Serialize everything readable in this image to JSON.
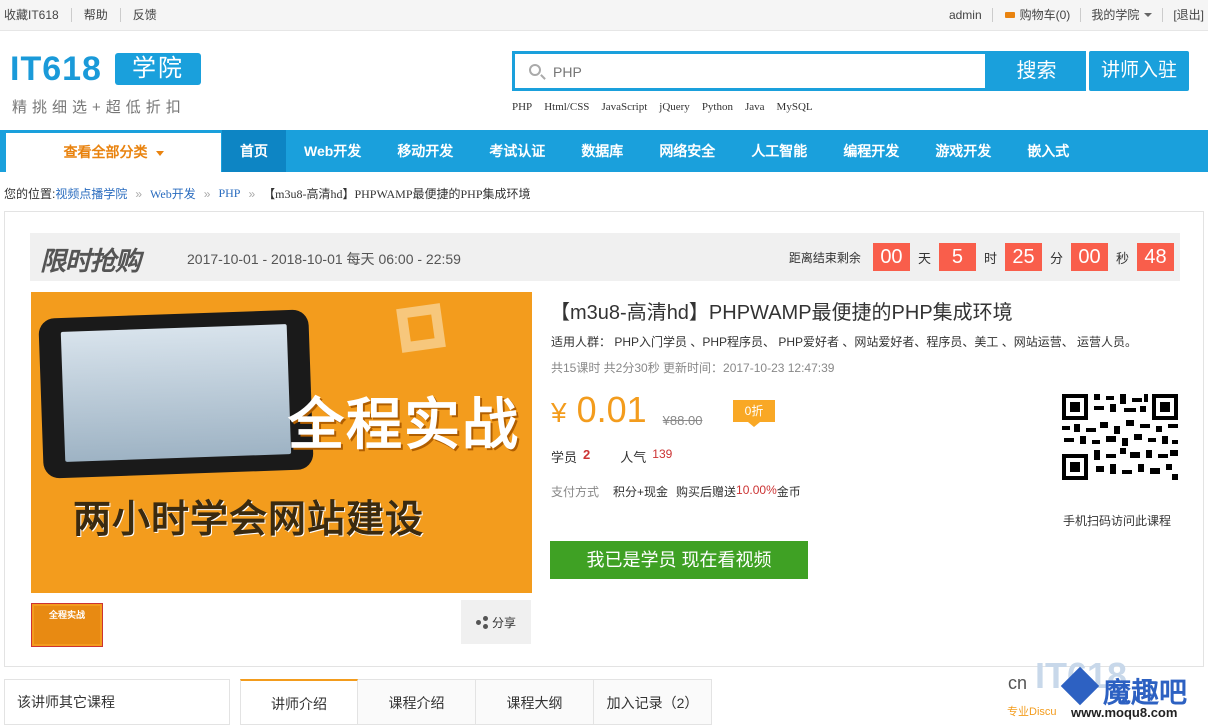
{
  "topbar": {
    "links": [
      "收藏IT618",
      "帮助",
      "反馈"
    ],
    "user": "admin",
    "cart": "购物车(0)",
    "my_school": "我的学院",
    "logout": "[退出]"
  },
  "header": {
    "logo_text": "IT618",
    "logo_badge": "学院",
    "slogan": "精挑细选+超低折扣",
    "search_placeholder": "PHP",
    "search_button": "搜索",
    "teacher_button": "讲师入驻",
    "hotwords": [
      "PHP",
      "Html/CSS",
      "JavaScript",
      "jQuery",
      "Python",
      "Java",
      "MySQL"
    ]
  },
  "nav": {
    "all_categories": "查看全部分类",
    "items": [
      "首页",
      "Web开发",
      "移动开发",
      "考试认证",
      "数据库",
      "网络安全",
      "人工智能",
      "编程开发",
      "游戏开发",
      "嵌入式"
    ]
  },
  "breadcrumb": {
    "label": "您的位置:",
    "items": [
      "视频点播学院",
      "Web开发",
      "PHP"
    ],
    "current": "【m3u8-高清hd】PHPWAMP最便捷的PHP集成环境",
    "separator": "»"
  },
  "flash_sale": {
    "title": "限时抢购",
    "date_range": "2017-10-01 - 2018-10-01 每天 06:00 - 22:59",
    "countdown_label": "距离结束剩余",
    "days": "00",
    "days_unit": "天",
    "hours": "5",
    "hours_unit": "时",
    "minutes": "25",
    "minutes_unit": "分",
    "seconds_a": "00",
    "seconds_unit": "秒",
    "seconds_b": "48"
  },
  "cover": {
    "line1": "全程实战",
    "line2": "两小时学会网站建设",
    "thumb_text": "全程实战"
  },
  "course": {
    "title": "【m3u8-高清hd】PHPWAMP最便捷的PHP集成环境",
    "audience": "适用人群： PHP入门学员 、PHP程序员、 PHP爱好者 、网站爱好者、程序员、美工 、网站运营、 运营人员。",
    "meta": "共15课时 共2分30秒 更新时间：2017-10-23 12:47:39",
    "currency": "¥",
    "price": "0.01",
    "original_price": "¥88.00",
    "discount": "0折",
    "students_label": "学员",
    "students": "2",
    "popularity_label": "人气",
    "popularity": "139",
    "pay_label": "支付方式",
    "pay_value": "积分+现金",
    "reward_prefix": "购买后赠送",
    "reward_pct": "10.00%",
    "reward_suffix": "金币",
    "watch_button": "我已是学员 现在看视频",
    "share": "分享",
    "qr_label": "手机扫码访问此课程"
  },
  "bottom": {
    "side_title": "该讲师其它课程",
    "tabs": [
      "讲师介绍",
      "课程介绍",
      "课程大纲",
      "加入记录（2）"
    ]
  },
  "watermark": {
    "cn": "cn",
    "it": "IT618",
    "moqu": "魔趣吧",
    "small": "专业Discu",
    "url": "www.moqu8.com"
  },
  "colors": {
    "primary": "#1aa0dc",
    "accent": "#f39c1d",
    "countdown": "#f95e4b",
    "watch": "#3fa124"
  }
}
